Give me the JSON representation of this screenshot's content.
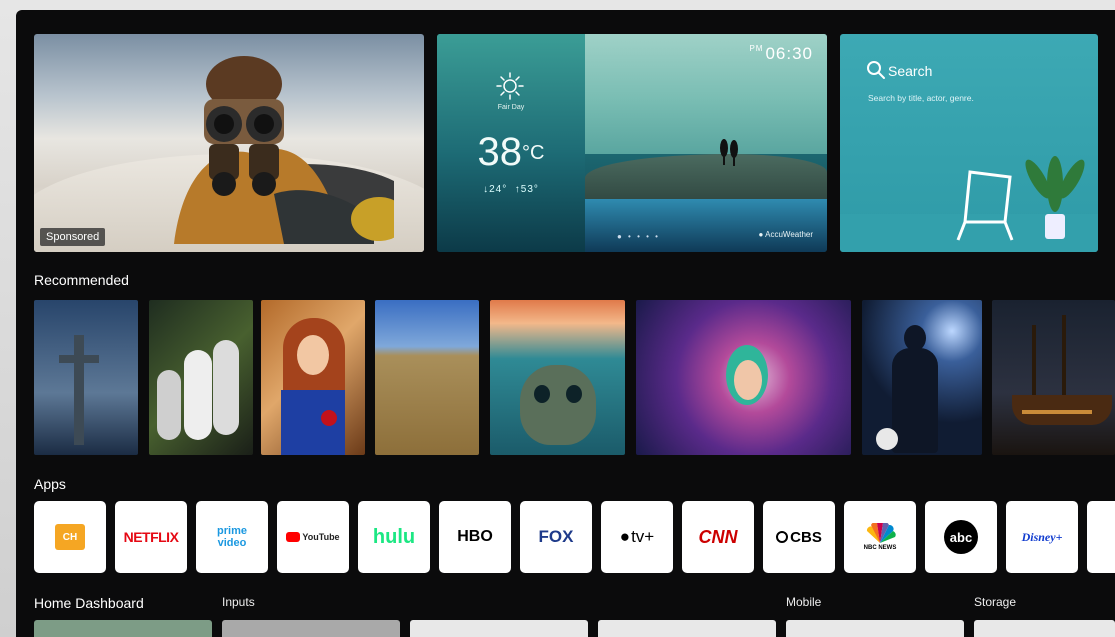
{
  "hero": {
    "badge": "Sponsored"
  },
  "weather": {
    "time_period": "PM",
    "time": "06:30",
    "condition": "Fair Day",
    "temperature": "38",
    "unit": "°C",
    "low": "↓24°",
    "high": "↑53°",
    "provider": "AccuWeather"
  },
  "search": {
    "title": "Search",
    "subtitle": "Search by title, actor, genre."
  },
  "sections": {
    "recommended": "Recommended",
    "apps": "Apps"
  },
  "recommended_items": [
    {
      "name": "rec-cross"
    },
    {
      "name": "rec-penguins"
    },
    {
      "name": "rec-redhead"
    },
    {
      "name": "rec-wheat-field"
    },
    {
      "name": "rec-skull-island"
    },
    {
      "name": "rec-flower-woman"
    },
    {
      "name": "rec-soccer-player"
    },
    {
      "name": "rec-pirate-ship"
    }
  ],
  "apps": [
    {
      "label": "CH",
      "color": "#f05a28",
      "type": "icon"
    },
    {
      "label": "NETFLIX",
      "color": "#e50914"
    },
    {
      "label": "prime video",
      "color": "#1b98e0"
    },
    {
      "label": "YouTube",
      "color": "#ff0000"
    },
    {
      "label": "hulu",
      "color": "#1ce783"
    },
    {
      "label": "HBO",
      "color": "#000000"
    },
    {
      "label": "FOX",
      "color": "#1e3a8a"
    },
    {
      "label": "tv+",
      "color": "#000000"
    },
    {
      "label": "CNN",
      "color": "#cc0000"
    },
    {
      "label": "CBS",
      "color": "#000000"
    },
    {
      "label": "NBC NEWS",
      "color": "#000000"
    },
    {
      "label": "abc",
      "color": "#000000"
    },
    {
      "label": "Disney+",
      "color": "#113ccf"
    }
  ],
  "dashboard": {
    "home": "Home Dashboard",
    "inputs": "Inputs",
    "mobile": "Mobile",
    "storage": "Storage"
  }
}
